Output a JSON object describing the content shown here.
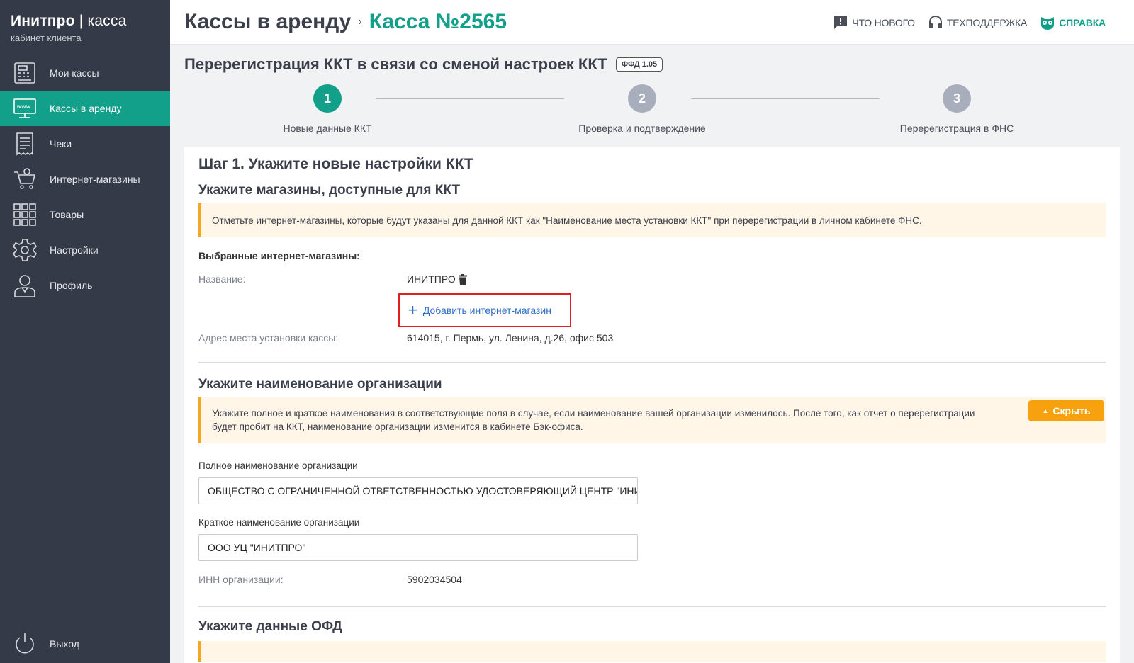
{
  "brand": {
    "name_bold": "Инитпро",
    "name_sep": " | ",
    "name_light": "касса",
    "subtitle": "кабинет клиента"
  },
  "sidebar": {
    "items": [
      {
        "label": "Мои кассы",
        "icon": "cash-register-icon"
      },
      {
        "label": "Кассы в аренду",
        "icon": "www-terminal-icon",
        "active": true
      },
      {
        "label": "Чеки",
        "icon": "receipt-icon"
      },
      {
        "label": "Интернет-магазины",
        "icon": "shopping-cart-icon"
      },
      {
        "label": "Товары",
        "icon": "grid-icon"
      },
      {
        "label": "Настройки",
        "icon": "gear-icon"
      },
      {
        "label": "Профиль",
        "icon": "user-icon"
      }
    ],
    "logout_label": "Выход"
  },
  "header": {
    "title": "Кассы в аренду",
    "separator": "›",
    "kassa": "Касса №2565",
    "links": {
      "whats_new": "ЧТО НОВОГО",
      "support": "ТЕХПОДДЕРЖКА",
      "help": "СПРАВКА"
    }
  },
  "page": {
    "title": "Перерегистрация ККТ в связи со сменой настроек ККТ",
    "badge": "ФФД 1.05"
  },
  "stepper": {
    "steps": [
      {
        "num": "1",
        "label": "Новые данные ККТ",
        "active": true
      },
      {
        "num": "2",
        "label": "Проверка и подтверждение",
        "active": false
      },
      {
        "num": "3",
        "label": "Перерегистрация в ФНС",
        "active": false
      }
    ]
  },
  "step1": {
    "title": "Шаг 1. Укажите новые настройки ККТ",
    "shops": {
      "heading": "Укажите магазины, доступные для ККТ",
      "note": "Отметьте интернет-магазины, которые будут указаны для данной ККТ как \"Наименование места установки ККТ\" при перерегистрации в личном кабинете ФНС.",
      "selected_label": "Выбранные интернет-магазины:",
      "name_key": "Название:",
      "name_value": "ИНИТПРО",
      "add_button": "Добавить интернет-магазин",
      "address_key": "Адрес места установки кассы:",
      "address_value": "614015, г. Пермь, ул. Ленина, д.26, офис 503"
    },
    "org": {
      "heading": "Укажите наименование организации",
      "note": "Укажите полное и краткое наименования в соответствующие поля в случае, если наименование вашей организации изменилось. После того, как отчет о перерегистрации будет пробит на ККТ, наименование организации изменится в кабинете Бэк-офиса.",
      "hide_button": "Скрыть",
      "full_label": "Полное наименование организации",
      "full_value": "ОБЩЕСТВО С ОГРАНИЧЕННОЙ ОТВЕТСТВЕННОСТЬЮ УДОСТОВЕРЯЮЩИЙ ЦЕНТР \"ИНИ",
      "short_label": "Краткое наименование организации",
      "short_value": "ООО УЦ \"ИНИТПРО\"",
      "inn_key": "ИНН организации:",
      "inn_value": "5902034504"
    },
    "ofd": {
      "heading": "Укажите данные ОФД"
    }
  },
  "colors": {
    "accent": "#12a08a",
    "sidebar": "#343a47",
    "warning": "#f6a10d",
    "link": "#2f6ec7",
    "highlight": "#e02020"
  }
}
